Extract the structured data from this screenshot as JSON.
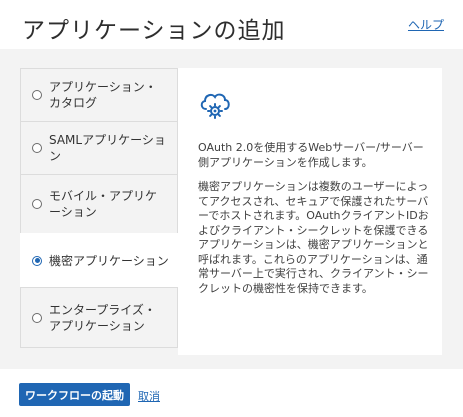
{
  "page": {
    "title": "アプリケーションの追加",
    "help_link": "ヘルプ"
  },
  "options": [
    {
      "label": "アプリケーション・カタログ",
      "selected": false
    },
    {
      "label": "SAMLアプリケーション",
      "selected": false
    },
    {
      "label": "モバイル・アプリケーション",
      "selected": false
    },
    {
      "label": "機密アプリケーション",
      "selected": true
    },
    {
      "label": "エンタープライズ・アプリケーション",
      "selected": false
    }
  ],
  "panel": {
    "icon": "cloud-gear-icon",
    "summary": "OAuth 2.0を使用するWebサーバー/サーバー側アプリケーションを作成します。",
    "description": "機密アプリケーションは複数のユーザーによってアクセスされ、セキュアで保護されたサーバーでホストされます。OAuthクライアントIDおよびクライアント・シークレットを保護できるアプリケーションは、機密アプリケーションと呼ばれます。これらのアプリケーションは、通常サーバー上で実行され、クライアント・シークレットの機密性を保持できます。"
  },
  "footer": {
    "launch_workflow": "ワークフローの起動",
    "cancel": "取消"
  },
  "colors": {
    "accent": "#1f66b3",
    "background": "#f3f3f3"
  }
}
